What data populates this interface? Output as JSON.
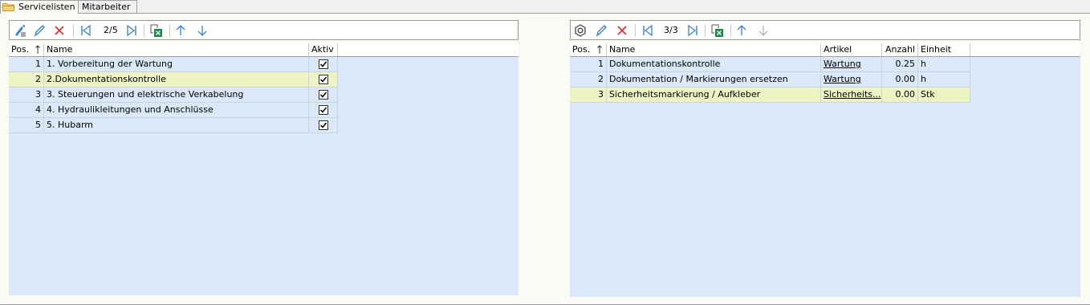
{
  "tabs": [
    {
      "label": "Servicelisten",
      "active": true
    },
    {
      "label": "Mitarbeiter",
      "active": false
    }
  ],
  "left_panel": {
    "toolbar": {
      "icons": [
        "checklist-edit-icon",
        "pencil-icon",
        "delete-x-icon",
        "first-record-icon",
        "last-record-icon",
        "excel-export-icon",
        "arrow-up-icon",
        "arrow-down-icon"
      ],
      "counter": "2/5"
    },
    "columns": {
      "pos": "Pos.",
      "name": "Name",
      "aktiv": "Aktiv"
    },
    "rows": [
      {
        "pos": "1",
        "name": "1. Vorbereitung der Wartung",
        "aktiv": true,
        "selected": false
      },
      {
        "pos": "2",
        "name": "2.Dokumentationskontrolle",
        "aktiv": true,
        "selected": true
      },
      {
        "pos": "3",
        "name": "3. Steuerungen und elektrische Verkabelung",
        "aktiv": true,
        "selected": false
      },
      {
        "pos": "4",
        "name": "4. Hydraulikleitungen und Anschlüsse",
        "aktiv": true,
        "selected": false
      },
      {
        "pos": "5",
        "name": "5. Hubarm",
        "aktiv": true,
        "selected": false
      }
    ]
  },
  "right_panel": {
    "toolbar": {
      "icons": [
        "hex-nut-icon",
        "pencil-icon",
        "delete-x-icon",
        "first-record-icon",
        "last-record-icon",
        "excel-export-icon",
        "arrow-up-icon",
        "arrow-down-icon"
      ],
      "counter": "3/3"
    },
    "columns": {
      "pos": "Pos.",
      "name": "Name",
      "artikel": "Artikel",
      "anzahl": "Anzahl",
      "einheit": "Einheit"
    },
    "rows": [
      {
        "pos": "1",
        "name": "Dokumentationskontrolle",
        "artikel": "Wartung",
        "anzahl": "0.25",
        "einheit": "h",
        "selected": false
      },
      {
        "pos": "2",
        "name": "Dokumentation / Markierungen ersetzen",
        "artikel": "Wartung",
        "anzahl": "0.00",
        "einheit": "h",
        "selected": false
      },
      {
        "pos": "3",
        "name": "Sicherheitsmarkierung / Aufkleber",
        "artikel": "Sicherheits...",
        "anzahl": "0.00",
        "einheit": "Stk",
        "selected": true
      }
    ]
  },
  "colors": {
    "grid_background": "#dbe8f8",
    "selected_row": "#eef3c4",
    "icon_blue": "#3c7fd0",
    "icon_red": "#d8362f",
    "frame_background": "#fbfbf6"
  }
}
